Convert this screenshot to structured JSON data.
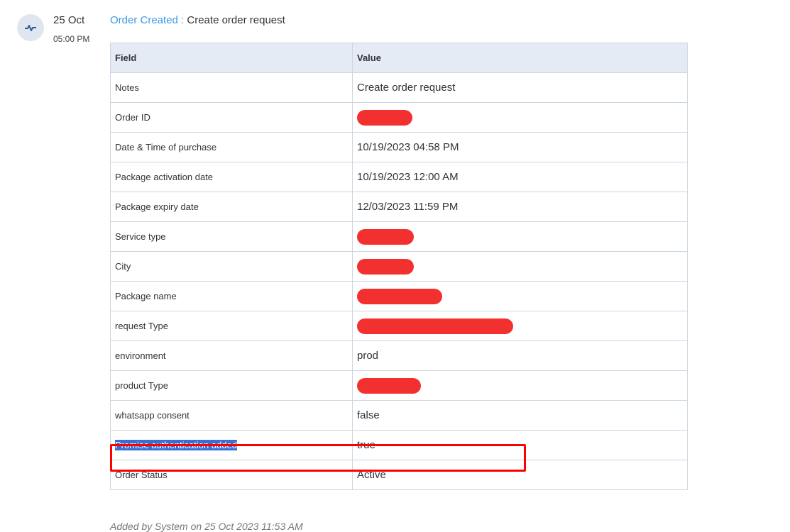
{
  "entry": {
    "date": "25 Oct",
    "time": "05:00 PM",
    "event": "Order Created :",
    "summary": "Create order request",
    "icon": "activity-pulse-icon"
  },
  "table": {
    "headers": [
      "Field",
      "Value"
    ],
    "rows": [
      {
        "field": "Notes",
        "value": "Create order request"
      },
      {
        "field": "Order ID",
        "value": null,
        "redacted": true
      },
      {
        "field": "Date & Time of purchase",
        "value": "10/19/2023 04:58 PM"
      },
      {
        "field": "Package activation date",
        "value": "10/19/2023 12:00 AM"
      },
      {
        "field": "Package expiry date",
        "value": "12/03/2023 11:59 PM"
      },
      {
        "field": "Service type",
        "value": null,
        "redacted": true
      },
      {
        "field": "City",
        "value": null,
        "redacted": true
      },
      {
        "field": "Package name",
        "value": null,
        "redacted": true
      },
      {
        "field": "request Type",
        "value": null,
        "redacted": true
      },
      {
        "field": "environment",
        "value": "prod"
      },
      {
        "field": "product Type",
        "value": null,
        "redacted": true
      },
      {
        "field": "whatsapp consent",
        "value": "false"
      },
      {
        "field": "Promise authentication added",
        "value": "true",
        "highlighted": true
      },
      {
        "field": "Order Status",
        "value": "Active"
      }
    ]
  },
  "footer": "Added by System on 25 Oct 2023 11:53 AM",
  "colors": {
    "accent": "#3a9ae8",
    "redaction": "#f21a1a",
    "highlight_box": "#ff0000",
    "selection": "#3a6fd0"
  }
}
